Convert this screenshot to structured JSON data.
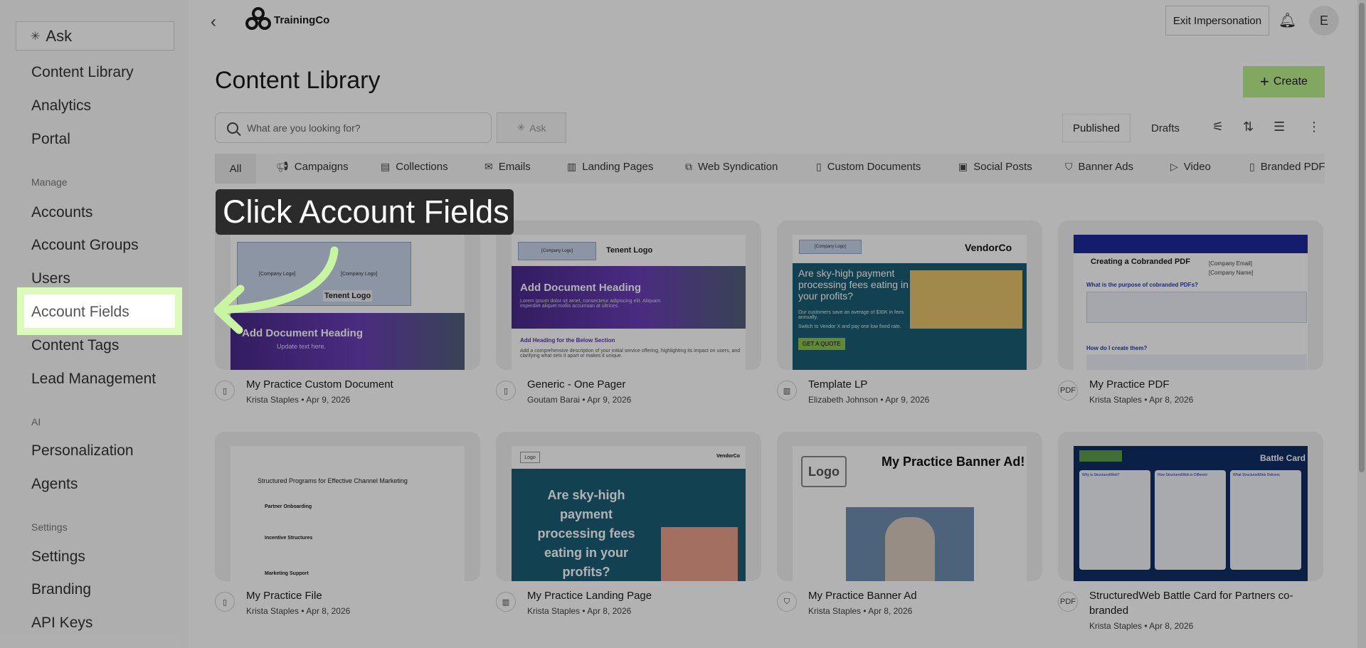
{
  "sidebar": {
    "ask_label": "Ask",
    "items_top": [
      "Content Library",
      "Analytics",
      "Portal"
    ],
    "manage_heading": "Manage",
    "items_manage": [
      "Accounts",
      "Account Groups",
      "Users",
      "Account Fields",
      "Content Tags",
      "Lead Management"
    ],
    "ai_heading": "AI",
    "items_ai": [
      "Personalization",
      "Agents"
    ],
    "settings_heading": "Settings",
    "items_settings": [
      "Settings",
      "Branding",
      "API Keys"
    ]
  },
  "topbar": {
    "brand": "TrainingCo",
    "exit_label": "Exit Impersonation",
    "avatar_initial": "E"
  },
  "main": {
    "title": "Content Library",
    "create_label": "Create",
    "search_placeholder": "What are you looking for?",
    "ask_label": "Ask",
    "published_label": "Published",
    "drafts_label": "Drafts",
    "tabs": [
      "All",
      "Campaigns",
      "Collections",
      "Emails",
      "Landing Pages",
      "Web Syndication",
      "Custom Documents",
      "Social Posts",
      "Banner Ads",
      "Video",
      "Branded PDF"
    ]
  },
  "cards": [
    {
      "title": "My Practice Custom Document",
      "author": "Krista Staples",
      "date": "Apr 9, 2026",
      "thumb": {
        "l1": "[Company Logo]",
        "l2": "[Company Logo]",
        "logo": "Tenent Logo",
        "heading": "Add Document Heading",
        "sub": "Update text here."
      }
    },
    {
      "title": "Generic - One Pager",
      "author": "Goutam Barai",
      "date": "Apr 9, 2026",
      "thumb": {
        "l1": "[Company Logo]",
        "logo": "Tenent Logo",
        "heading": "Add Document Heading",
        "body": "Lorem ipsum dolor sit amet, consectetur adipiscing elit. Aliquam imperdiet aliquet mollis accumsan at ultrices.",
        "sub": "Add Heading for the Below Section",
        "desc": "Add a comprehensive description of your initial service offering, highlighting its impact on users, and clarifying what sets it apart or makes it unique."
      }
    },
    {
      "title": "Template LP",
      "author": "Elizabeth Johnson",
      "date": "Apr 9, 2026",
      "thumb": {
        "l1": "[Company Logo]",
        "vendor": "VendorCo",
        "heading": "Are sky-high payment processing fees eating in your profits?",
        "body": "Our customers save an average of $30K in fees annually.",
        "body2": "Switch to Vendor X and pay one low fixed rate.",
        "cta": "GET A QUOTE"
      }
    },
    {
      "title": "My Practice PDF",
      "author": "Krista Staples",
      "date": "Apr 8, 2026",
      "thumb": {
        "heading": "Creating a Cobranded PDF",
        "email": "[Company Email]",
        "name": "[Company Name]",
        "q1": "What is the purpose of cobranded PDFs?",
        "q2": "How do I create them?"
      }
    },
    {
      "title": "My Practice File",
      "author": "Krista Staples",
      "date": "Apr 8, 2026",
      "thumb": {
        "heading": "Structured Programs for Effective Channel Marketing",
        "s1": "Partner Onboarding",
        "s2": "Incentive Structures",
        "s3": "Marketing Support"
      }
    },
    {
      "title": "My Practice Landing Page",
      "author": "Krista Staples",
      "date": "Apr 8, 2026",
      "thumb": {
        "logo": "Logo",
        "vendor": "VendorCo",
        "heading": "Are sky-high payment processing fees eating in your profits?"
      }
    },
    {
      "title": "My Practice Banner Ad",
      "author": "Krista Staples",
      "date": "Apr 8, 2026",
      "thumb": {
        "logo": "Logo",
        "heading": "My Practice Banner Ad!"
      }
    },
    {
      "title": "StructuredWeb Battle Card for Partners co-branded",
      "author": "Krista Staples",
      "date": "Apr 8, 2026",
      "thumb": {
        "heading": "Battle Card",
        "c1": "Why is StructuredWeb?",
        "c2": "How StructuredWeb is Different",
        "c3": "What StructuredWeb Delivers"
      }
    }
  ],
  "guide": {
    "callout": "Click Account Fields"
  },
  "colors": {
    "accent_green": "#b9f08c",
    "highlight": "#d9fdb8",
    "callout_bg": "#2b2b2b"
  }
}
